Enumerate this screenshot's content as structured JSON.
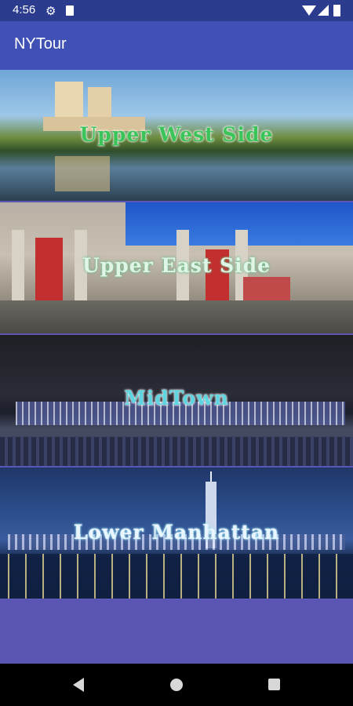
{
  "status_bar": {
    "time": "4:56",
    "icons": [
      "gear-icon",
      "sd-card-icon",
      "wifi-icon",
      "signal-icon",
      "battery-icon"
    ]
  },
  "app_bar": {
    "title": "NYTour"
  },
  "neighborhoods": [
    {
      "label": "Upper West Side"
    },
    {
      "label": "Upper East Side"
    },
    {
      "label": "MidTown"
    },
    {
      "label": "Lower Manhattan"
    }
  ],
  "nav_bar": {
    "icons": [
      "back-icon",
      "home-icon",
      "recents-icon"
    ]
  },
  "colors": {
    "app_bar": "#3F51B5",
    "status_bar": "#2B3C8F",
    "background": "#5B55B3"
  }
}
